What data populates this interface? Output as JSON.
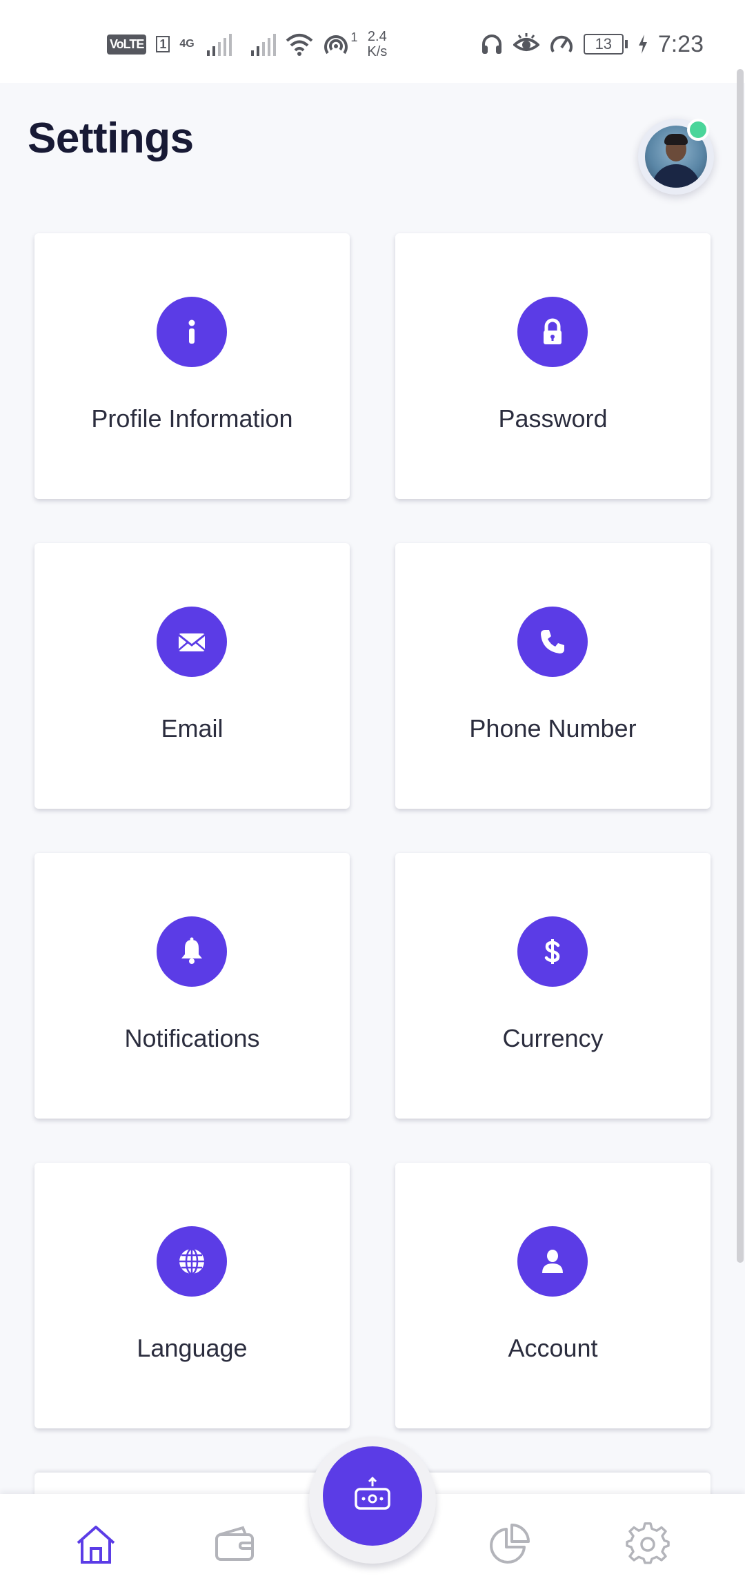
{
  "status_bar": {
    "carrier_badge": "VoLTE",
    "sim": "1",
    "network": "4G",
    "hotspot_count": "1",
    "speed_value": "2.4",
    "speed_unit": "K/s",
    "battery": "13",
    "time": "7:23"
  },
  "header": {
    "title": "Settings"
  },
  "colors": {
    "accent": "#5b3ce6",
    "online": "#4ad59a",
    "background": "#f7f8fb"
  },
  "cards": [
    {
      "label": "Profile Information",
      "icon": "info-icon"
    },
    {
      "label": "Password",
      "icon": "lock-icon"
    },
    {
      "label": "Email",
      "icon": "envelope-icon"
    },
    {
      "label": "Phone Number",
      "icon": "phone-icon"
    },
    {
      "label": "Notifications",
      "icon": "bell-icon"
    },
    {
      "label": "Currency",
      "icon": "dollar-icon"
    },
    {
      "label": "Language",
      "icon": "globe-icon"
    },
    {
      "label": "Account",
      "icon": "user-icon"
    }
  ],
  "bottom_nav": {
    "items": [
      {
        "icon": "home-icon",
        "active": true
      },
      {
        "icon": "wallet-icon",
        "active": false
      },
      {
        "icon": "robot-icon",
        "active": false
      },
      {
        "icon": "pie-chart-icon",
        "active": false
      },
      {
        "icon": "gear-icon",
        "active": false
      }
    ]
  }
}
